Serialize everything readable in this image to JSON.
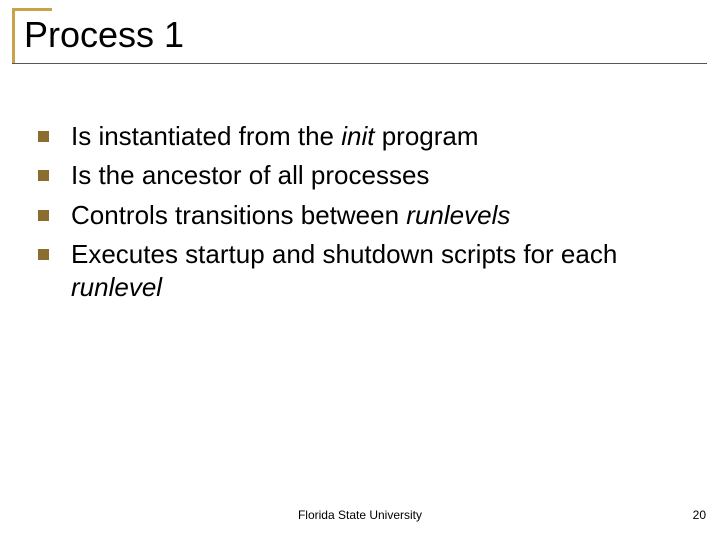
{
  "slide": {
    "title": "Process 1",
    "bullets": [
      {
        "pre": "Is instantiated from the ",
        "em": "init",
        "post": " program"
      },
      {
        "pre": "Is the ancestor of all processes",
        "em": "",
        "post": ""
      },
      {
        "pre": "Controls transitions between ",
        "em": "runlevels",
        "post": ""
      },
      {
        "pre": "Executes startup and shutdown scripts for each ",
        "em": "runlevel",
        "post": ""
      }
    ],
    "footer_center": "Florida State University",
    "footer_page": "20"
  }
}
